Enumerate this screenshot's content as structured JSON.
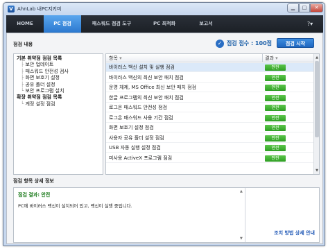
{
  "window": {
    "title": "AhnLab 내PC지키미",
    "icon": "ahnlab-logo-icon"
  },
  "nav": {
    "tabs": [
      {
        "label": "HOME",
        "active": false
      },
      {
        "label": "PC 점검",
        "active": true
      },
      {
        "label": "패스워드 점검 도구",
        "active": false
      },
      {
        "label": "PC 최적화",
        "active": false
      },
      {
        "label": "보고서",
        "active": false
      }
    ],
    "help": "?▾"
  },
  "check": {
    "section_title": "점검 내용",
    "score_label": "점검 점수 : 100점",
    "start_button": "점검 시작"
  },
  "tree": [
    {
      "label": "기본 취약점 점검 목록",
      "level": 0
    },
    {
      "label": "보안 업데이트",
      "level": 1
    },
    {
      "label": "패스워드 안전성 검사",
      "level": 1
    },
    {
      "label": "화면 보호기 설정",
      "level": 1
    },
    {
      "label": "공유 폴더 설정",
      "level": 1
    },
    {
      "label": "보안 프로그램 설치",
      "level": 1
    },
    {
      "label": "확장 취약점 점검 목록",
      "level": 0
    },
    {
      "label": "계정 설정 점검",
      "level": 1
    }
  ],
  "table": {
    "col_item": "항목",
    "col_result": "결과",
    "sort_icon": "sort-down-icon",
    "rows": [
      {
        "item": "바이러스 백신 설치 및 실행 점검",
        "result": "안전"
      },
      {
        "item": "바이러스 백신의 최신 보안 패치 점검",
        "result": "안전"
      },
      {
        "item": "운영 체제, MS Office 최신 보안 패치 점검",
        "result": "안전"
      },
      {
        "item": "한글 프로그램의 최신 보안 패치 점검",
        "result": "안전"
      },
      {
        "item": "로그온 패스워드 안전성 점검",
        "result": "안전"
      },
      {
        "item": "로그온 패스워드 사용 기간 점검",
        "result": "안전"
      },
      {
        "item": "화면 보호기 설정 점검",
        "result": "안전"
      },
      {
        "item": "사용자 공유 폴더 설정 점검",
        "result": "안전"
      },
      {
        "item": "USB 자동 실행 설정 점검",
        "result": "안전"
      },
      {
        "item": "미사용 ActiveX 프로그램 점검",
        "result": "안전"
      }
    ]
  },
  "detail": {
    "section_title": "점검 항목 상세 정보",
    "result_label": "점검 결과: 안전",
    "description": "PC에 바이러스 백신이 설치되어 있고, 백신이 실행 중입니다.",
    "guide_link": "조치 방법 상세 안내"
  }
}
